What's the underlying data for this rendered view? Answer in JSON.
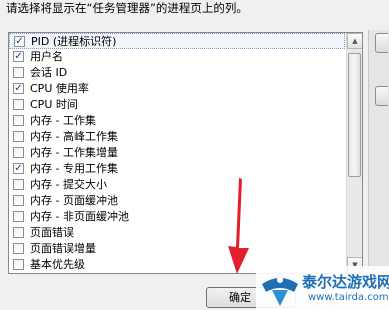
{
  "instruction": "请选择将显示在“任务管理器”的进程页上的列。",
  "columns": [
    {
      "label": "PID (进程标识符)",
      "checked": true
    },
    {
      "label": "用户名",
      "checked": true
    },
    {
      "label": "会话 ID",
      "checked": false
    },
    {
      "label": "CPU 使用率",
      "checked": true
    },
    {
      "label": "CPU 时间",
      "checked": false
    },
    {
      "label": "内存 - 工作集",
      "checked": false
    },
    {
      "label": "内存 - 高峰工作集",
      "checked": false
    },
    {
      "label": "内存 - 工作集增量",
      "checked": false
    },
    {
      "label": "内存 - 专用工作集",
      "checked": true
    },
    {
      "label": "内存 - 提交大小",
      "checked": false
    },
    {
      "label": "内存 - 页面缓冲池",
      "checked": false
    },
    {
      "label": "内存 - 非页面缓冲池",
      "checked": false
    },
    {
      "label": "页面错误",
      "checked": false
    },
    {
      "label": "页面错误增量",
      "checked": false
    },
    {
      "label": "基本优先级",
      "checked": false
    }
  ],
  "ok_button": {
    "label": "确定"
  },
  "watermark": {
    "text": "泰尔达游戏网",
    "url": "www.tairda.com"
  },
  "colors": {
    "arrow": "#e0202a",
    "watermark": "#1f6fb5",
    "check": "#1d3f86"
  }
}
